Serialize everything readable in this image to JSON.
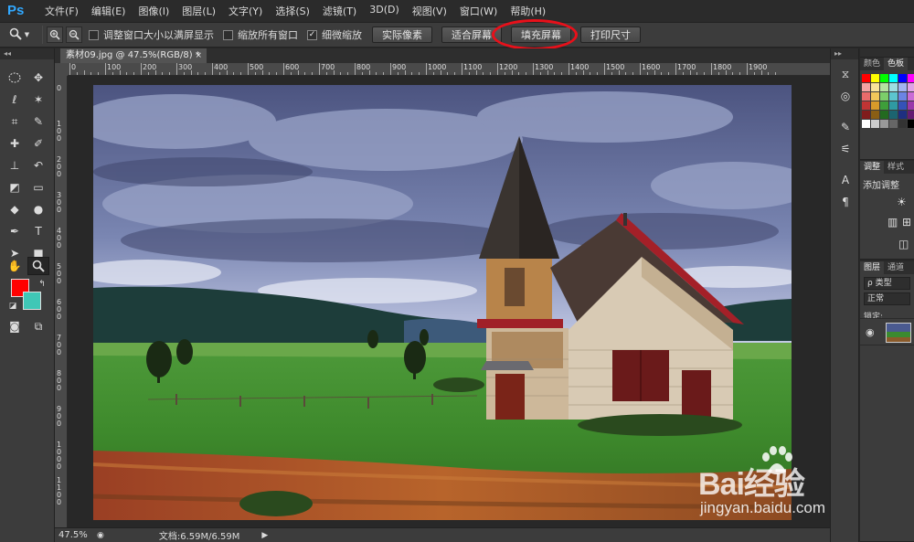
{
  "app": {
    "logo": "Ps"
  },
  "menu": [
    "文件(F)",
    "编辑(E)",
    "图像(I)",
    "图层(L)",
    "文字(Y)",
    "选择(S)",
    "滤镜(T)",
    "3D(D)",
    "视图(V)",
    "窗口(W)",
    "帮助(H)"
  ],
  "options": {
    "resize_windows_label": "调整窗口大小以满屏显示",
    "resize_windows_checked": false,
    "zoom_all_label": "缩放所有窗口",
    "zoom_all_checked": false,
    "scrubby_zoom_label": "细微缩放",
    "scrubby_zoom_checked": true,
    "actual_pixels_label": "实际像素",
    "fit_screen_label": "适合屏幕",
    "fill_screen_label": "填充屏幕",
    "print_size_label": "打印尺寸"
  },
  "document": {
    "tab_title": "素材09.jpg @ 47.5%(RGB/8) *",
    "close_glyph": "×"
  },
  "ruler": {
    "top_labels": [
      "0",
      "100",
      "200",
      "300",
      "400",
      "500",
      "600",
      "700",
      "800",
      "900",
      "1000",
      "1100",
      "1200",
      "1300",
      "1400",
      "1500",
      "1600",
      "1700",
      "1800",
      "1900"
    ],
    "left_labels": [
      "0",
      "100",
      "200",
      "300",
      "400",
      "500",
      "600",
      "700",
      "800",
      "900",
      "1000",
      "1100"
    ]
  },
  "status": {
    "zoom": "47.5%",
    "doc_info": "文档:6.59M/6.59M",
    "arrow": "▶"
  },
  "colors": {
    "foreground": "#ff0000",
    "background": "#3fc7b6",
    "highlight_circle": "#e8101a"
  },
  "panels": {
    "color_tabs": [
      "颜色",
      "色板"
    ],
    "adjust_tabs": [
      "调整",
      "样式"
    ],
    "adjust_title": "添加调整",
    "layers_tabs": [
      "图层",
      "通道"
    ],
    "layers_filter": "ρ 类型",
    "blend_mode": "正常",
    "lock_label": "锁定:"
  },
  "watermark": {
    "brand": "Bai经验",
    "url": "jingyan.baidu.com"
  }
}
